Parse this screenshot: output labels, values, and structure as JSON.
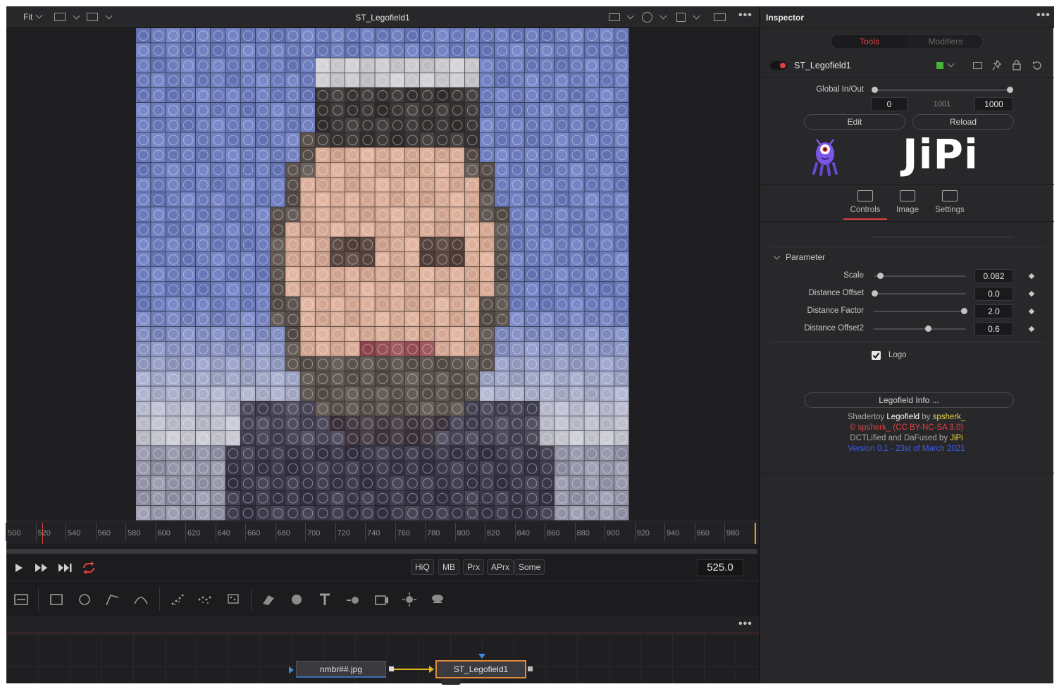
{
  "viewer": {
    "fit_label": "Fit",
    "title": "ST_Legofield1"
  },
  "timeline": {
    "ticks": [
      "500",
      "520",
      "540",
      "560",
      "580",
      "600",
      "620",
      "640",
      "660",
      "680",
      "700",
      "720",
      "740",
      "760",
      "780",
      "800",
      "820",
      "840",
      "860",
      "880",
      "900",
      "920",
      "940",
      "960",
      "980"
    ],
    "current_frame": "525.0"
  },
  "transport": {
    "buttons": [
      "HiQ",
      "MB",
      "Prx",
      "APrx",
      "Some"
    ]
  },
  "nodes": {
    "loader": "nmbr##.jpg",
    "effect": "ST_Legofield1"
  },
  "inspector": {
    "title": "Inspector",
    "tab_tools": "Tools",
    "tab_modifiers": "Modifiers",
    "tool_name": "ST_Legofield1",
    "global_inout_label": "Global In/Out",
    "global_in": "0",
    "global_mid": "1001",
    "global_out": "1000",
    "edit_button": "Edit",
    "reload_button": "Reload",
    "logo_text": "JiPi",
    "tabs": {
      "controls": "Controls",
      "image": "Image",
      "settings": "Settings"
    },
    "section_parameter": "Parameter",
    "params": [
      {
        "label": "Scale",
        "value": "0.082",
        "level": 0.06
      },
      {
        "label": "Distance Offset",
        "value": "0.0",
        "level": 0.0
      },
      {
        "label": "Distance Factor",
        "value": "2.0",
        "level": 0.97
      },
      {
        "label": "Distance Offset2",
        "value": "0.6",
        "level": 0.58
      }
    ],
    "logo_checkbox": "Logo",
    "info_button": "Legofield Info ...",
    "footer": {
      "line1_a": "Shadertoy ",
      "line1_b": "Legofield",
      "line1_c": " by ",
      "line1_d": "spsherk_",
      "line2": "© spsherk_ (CC BY-NC-SA 3.0)",
      "line3_a": "DCTLified and DaFused by ",
      "line3_b": "JiPi",
      "line4": "Version 0.1 - 23st of March 2021"
    }
  },
  "colors": {
    "accent_red": "#e0403f",
    "yellow": "#e8d640",
    "blue_version": "#3d5be8",
    "node_selected_border": "#e08a3a"
  }
}
